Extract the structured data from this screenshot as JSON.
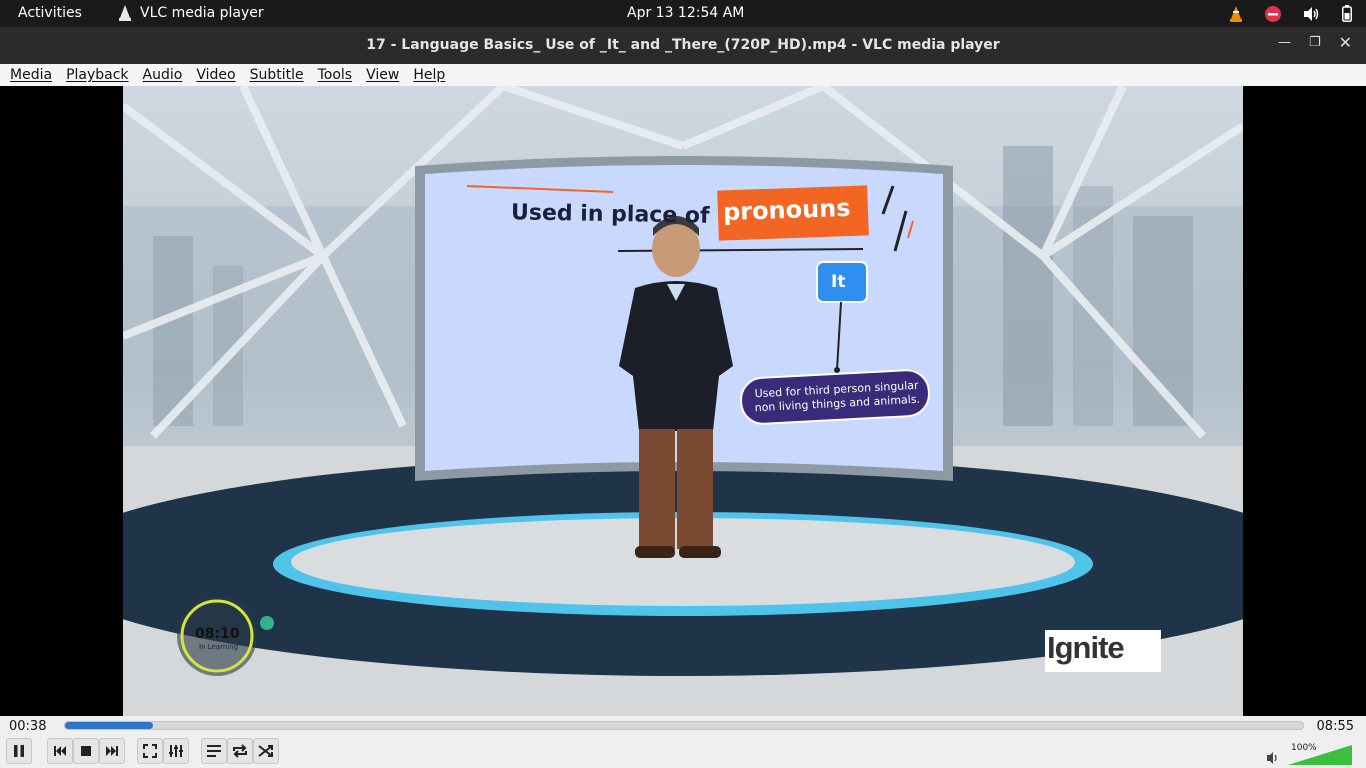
{
  "topbar": {
    "activities": "Activities",
    "app_name": "VLC media player",
    "clock": "Apr 13  12:54 AM"
  },
  "window": {
    "title": "17 - Language Basics_ Use of _It_ and _There_(720P_HD).mp4 - VLC media player"
  },
  "menu": {
    "items": [
      "Media",
      "Playback",
      "Audio",
      "Video",
      "Subtitle",
      "Tools",
      "View",
      "Help"
    ]
  },
  "video": {
    "heading_part1": "Used in place of",
    "heading_part2": "pronouns",
    "box_label": "It",
    "caption_line1": "Used for third person singular",
    "caption_line2": "non living things and animals.",
    "timer": "08:10",
    "timer_sub": "In Learning",
    "logo": "Ignite"
  },
  "player": {
    "current_time": "00:38",
    "total_time": "08:55",
    "progress": 0.071,
    "volume_label": "100%",
    "volume": 1.0
  },
  "colors": {
    "accent": "#2f74c8",
    "volume_green": "#3cbf3c",
    "highlight_orange": "#f26522",
    "it_blue": "#2f8ff0",
    "caption_purple": "#3a2a7a"
  }
}
